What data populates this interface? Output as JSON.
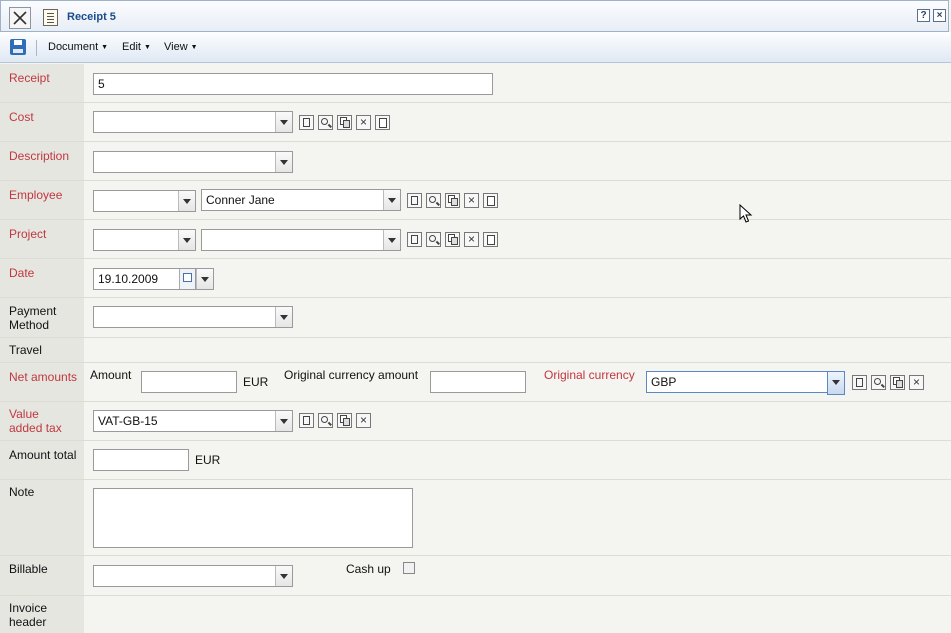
{
  "window": {
    "title": "Receipt 5",
    "help": "?",
    "close": "×"
  },
  "menu": [
    {
      "label": "Document"
    },
    {
      "label": "Edit"
    },
    {
      "label": "View"
    }
  ],
  "form": {
    "receipt": {
      "label": "Receipt",
      "value": "5"
    },
    "cost": {
      "label": "Cost",
      "value": ""
    },
    "description": {
      "label": "Description",
      "value": ""
    },
    "employee": {
      "label": "Employee",
      "code": "",
      "name": "Conner Jane"
    },
    "project": {
      "label": "Project",
      "code": "",
      "name": ""
    },
    "date": {
      "label": "Date",
      "value": "19.10.2009"
    },
    "payment_method": {
      "label": "Payment\nMethod",
      "value": ""
    },
    "travel": {
      "label": "Travel"
    },
    "net_amounts": {
      "label": "Net amounts",
      "amount_label": "Amount",
      "amount": "",
      "amount_currency": "EUR",
      "original_amount_label": "Original currency amount",
      "original_amount": "",
      "original_currency_label": "Original currency",
      "original_currency": "GBP"
    },
    "vat": {
      "label": "Value\nadded tax",
      "value": "VAT-GB-15"
    },
    "amount_total": {
      "label": "Amount total",
      "value": "",
      "currency": "EUR"
    },
    "note": {
      "label": "Note",
      "value": ""
    },
    "billable": {
      "label": "Billable",
      "value": "",
      "cash_up_label": "Cash up",
      "cash_up": false
    },
    "invoice_header": {
      "label": "Invoice\nheader"
    }
  }
}
